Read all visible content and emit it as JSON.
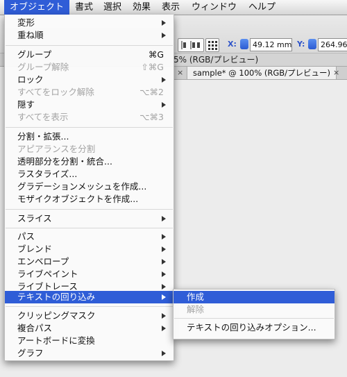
{
  "menubar": {
    "items": [
      {
        "label": "オブジェクト"
      },
      {
        "label": "書式"
      },
      {
        "label": "選択"
      },
      {
        "label": "効果"
      },
      {
        "label": "表示"
      },
      {
        "label": "ウィンドウ"
      },
      {
        "label": "ヘルプ"
      }
    ]
  },
  "toolbar": {
    "x_label": "X:",
    "x_value": "49.12 mm",
    "y_label": "Y:",
    "y_value": "264.962"
  },
  "tabs": {
    "partial_title": "5% (RGB/プレビュー)",
    "document_title": "sample* @ 100% (RGB/プレビュー)",
    "close_glyph": "×"
  },
  "menu": {
    "items": [
      {
        "label": "変形",
        "shortcut": "",
        "submenu": true,
        "enabled": true
      },
      {
        "label": "重ね順",
        "shortcut": "",
        "submenu": true,
        "enabled": true
      },
      {
        "label": "グループ",
        "shortcut": "⌘G",
        "submenu": false,
        "enabled": true
      },
      {
        "label": "グループ解除",
        "shortcut": "⇧⌘G",
        "submenu": false,
        "enabled": false
      },
      {
        "label": "ロック",
        "shortcut": "",
        "submenu": true,
        "enabled": true
      },
      {
        "label": "すべてをロック解除",
        "shortcut": "⌥⌘2",
        "submenu": false,
        "enabled": false
      },
      {
        "label": "隠す",
        "shortcut": "",
        "submenu": true,
        "enabled": true
      },
      {
        "label": "すべてを表示",
        "shortcut": "⌥⌘3",
        "submenu": false,
        "enabled": false
      },
      {
        "label": "分割・拡張...",
        "shortcut": "",
        "submenu": false,
        "enabled": true
      },
      {
        "label": "アピアランスを分割",
        "shortcut": "",
        "submenu": false,
        "enabled": false
      },
      {
        "label": "透明部分を分割・統合...",
        "shortcut": "",
        "submenu": false,
        "enabled": true
      },
      {
        "label": "ラスタライズ...",
        "shortcut": "",
        "submenu": false,
        "enabled": true
      },
      {
        "label": "グラデーションメッシュを作成...",
        "shortcut": "",
        "submenu": false,
        "enabled": true
      },
      {
        "label": "モザイクオブジェクトを作成...",
        "shortcut": "",
        "submenu": false,
        "enabled": true
      },
      {
        "label": "スライス",
        "shortcut": "",
        "submenu": true,
        "enabled": true
      },
      {
        "label": "パス",
        "shortcut": "",
        "submenu": true,
        "enabled": true
      },
      {
        "label": "ブレンド",
        "shortcut": "",
        "submenu": true,
        "enabled": true
      },
      {
        "label": "エンベロープ",
        "shortcut": "",
        "submenu": true,
        "enabled": true
      },
      {
        "label": "ライブペイント",
        "shortcut": "",
        "submenu": true,
        "enabled": true
      },
      {
        "label": "ライブトレース",
        "shortcut": "",
        "submenu": true,
        "enabled": true
      },
      {
        "label": "テキストの回り込み",
        "shortcut": "",
        "submenu": true,
        "enabled": true,
        "highlighted": true
      },
      {
        "label": "クリッピングマスク",
        "shortcut": "",
        "submenu": true,
        "enabled": true
      },
      {
        "label": "複合パス",
        "shortcut": "",
        "submenu": true,
        "enabled": true
      },
      {
        "label": "アートボードに変換",
        "shortcut": "",
        "submenu": false,
        "enabled": true
      },
      {
        "label": "グラフ",
        "shortcut": "",
        "submenu": true,
        "enabled": true
      }
    ]
  },
  "submenu": {
    "items": [
      {
        "label": "作成",
        "enabled": true,
        "highlighted": true
      },
      {
        "label": "解除",
        "enabled": false
      },
      {
        "label": "テキストの回り込みオプション...",
        "enabled": true
      }
    ]
  },
  "colors": {
    "highlight": "#2f5dd7",
    "disabled_text": "#a3a3a3"
  }
}
